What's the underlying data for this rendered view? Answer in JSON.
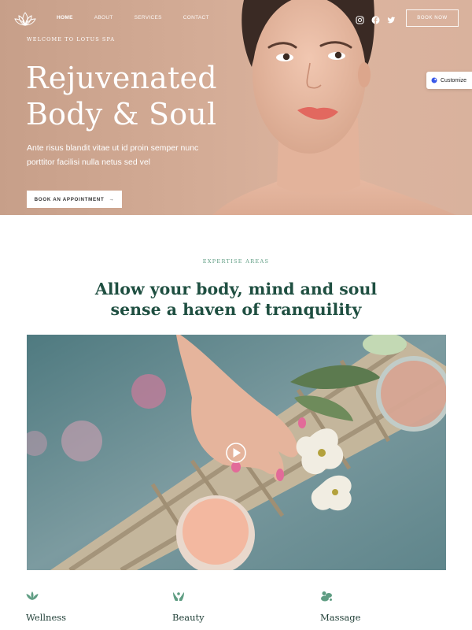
{
  "header": {
    "nav": [
      {
        "label": "HOME",
        "active": true
      },
      {
        "label": "ABOUT",
        "active": false
      },
      {
        "label": "SERVICES",
        "active": false
      },
      {
        "label": "CONTACT",
        "active": false
      }
    ],
    "social": [
      "instagram-icon",
      "facebook-icon",
      "twitter-icon"
    ],
    "book_now": "BOOK NOW"
  },
  "customize": {
    "label": "Customize"
  },
  "hero": {
    "eyebrow": "WELCOME TO LOTUS SPA",
    "title_line1": "Rejuvenated",
    "title_line2": "Body & Soul",
    "subtitle": "Ante risus blandit vitae ut id proin semper nunc porttitor facilisi nulla netus sed vel",
    "cta": "BOOK AN APPOINTMENT",
    "cta_arrow": "→"
  },
  "section": {
    "eyebrow": "EXPERTISE AREAS",
    "title_line1": "Allow your body, mind and soul",
    "title_line2": "sense a haven of tranquility"
  },
  "features": [
    {
      "label": "Wellness",
      "icon": "lotus-icon"
    },
    {
      "label": "Beauty",
      "icon": "hands-icon"
    },
    {
      "label": "Massage",
      "icon": "spa-stones-icon"
    }
  ],
  "colors": {
    "hero_bg": "#d3ab95",
    "accent_green": "#5f9d83",
    "heading_green": "#1f4f41"
  }
}
